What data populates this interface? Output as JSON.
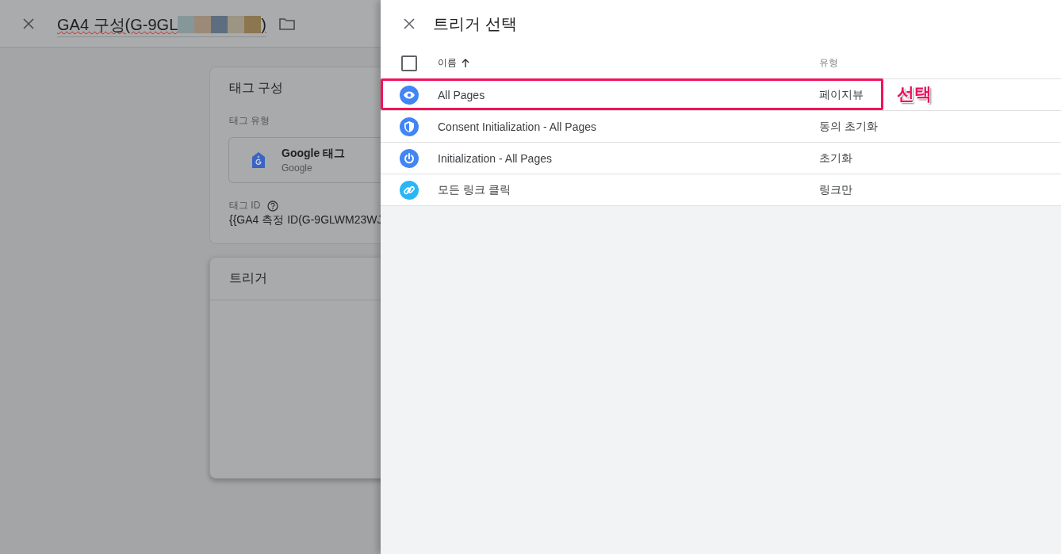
{
  "editor": {
    "title_start": "GA4 구성(G-9GL",
    "title_end": ")",
    "tag_card": {
      "title": "태그 구성",
      "type_label": "태그 유형",
      "tag_name": "Google 태그",
      "tag_vendor": "Google",
      "id_label": "태그 ID",
      "id_value": "{{GA4 측정 ID(G-9GLWM23WJ"
    },
    "trigger_card": {
      "title": "트리거"
    }
  },
  "panel": {
    "title": "트리거 선택",
    "columns": [
      {
        "label": "이름",
        "sorted": true
      },
      {
        "label": "유형",
        "sorted": false
      }
    ],
    "select_all": {
      "checked": false
    },
    "rows": [
      {
        "name": "All Pages",
        "type": "페이지뷰",
        "kind": "eye",
        "color": "#4285f4",
        "highlighted": true
      },
      {
        "name": "Consent Initialization - All Pages",
        "type": "동의 초기화",
        "kind": "shield",
        "color": "#4285f4",
        "highlighted": false
      },
      {
        "name": "Initialization - All Pages",
        "type": "초기화",
        "kind": "power",
        "color": "#4285f4",
        "highlighted": false
      },
      {
        "name": "모든 링크 클릭",
        "type": "링크만",
        "kind": "link",
        "color": "#29b6f6",
        "highlighted": false
      }
    ],
    "annotation": "선택"
  }
}
